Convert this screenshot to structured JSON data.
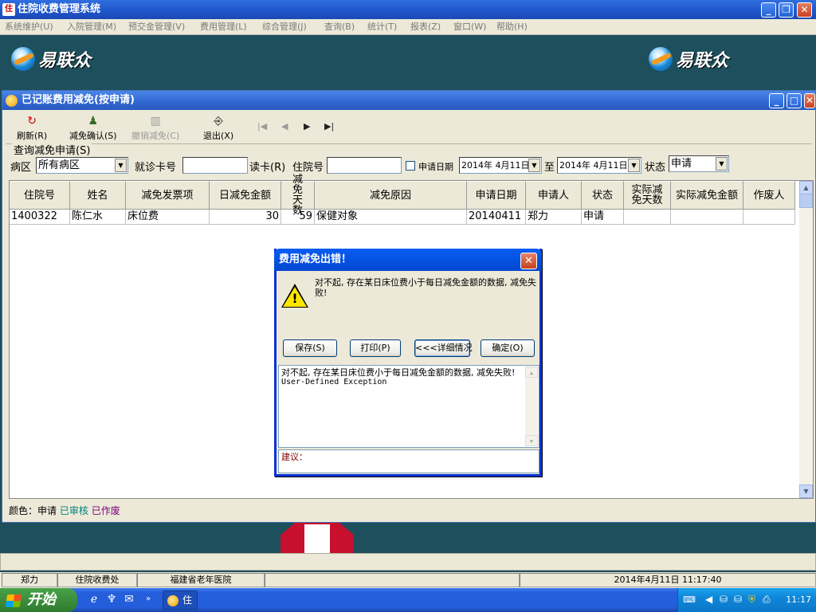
{
  "app": {
    "title": "住院收费管理系统",
    "icon": "app-logo-icon"
  },
  "menu": [
    "系统维护(U)",
    "入院管理(M)",
    "预交金管理(V)",
    "费用管理(L)",
    "综合管理(J)",
    "查询(B)",
    "统计(T)",
    "报表(Z)",
    "窗口(W)",
    "帮助(H)"
  ],
  "brand": {
    "logo_text": "易联众"
  },
  "window": {
    "title": "已记账费用减免(按申请)"
  },
  "toolbar": {
    "refresh": "刷新(R)",
    "confirm": "减免确认(S)",
    "cancel": "撤销减免(C)",
    "exit": "退出(X)",
    "nav_first": "|◀",
    "nav_prev": "◀",
    "nav_next": "▶",
    "nav_last": "▶|"
  },
  "query": {
    "group_label": "查询减免申请(S)",
    "ward_label": "病区",
    "ward_value": "所有病区",
    "card_label": "就诊卡号",
    "card_value": "",
    "read_card": "读卡(R)",
    "inpatient_label": "住院号",
    "inpatient_value": "",
    "date_check_label": "申请日期",
    "date_from": "2014年 4月11日",
    "to_label": "至",
    "date_to": "2014年 4月11日",
    "status_label": "状态",
    "status_value": "申请"
  },
  "grid": {
    "headers": [
      "住院号",
      "姓名",
      "减免发票项",
      "日减免金额",
      "减免天数",
      "减免原因",
      "申请日期",
      "申请人",
      "状态",
      "实际减免天数",
      "实际减免金额",
      "作废人"
    ],
    "rows": [
      [
        "1400322",
        "陈仁水",
        "床位费",
        "30",
        "59",
        "保健对象",
        "20140411",
        "郑力",
        "申请",
        "",
        "",
        ""
      ]
    ]
  },
  "legend": {
    "prefix": "颜色：",
    "applied": "申请",
    "reviewed": "已审核",
    "voided": "已作废",
    "colors": {
      "applied": "#000000",
      "reviewed": "#008080",
      "voided": "#800080"
    }
  },
  "dialog": {
    "title": "费用减免出错！",
    "message": "对不起, 存在某日床位费小于每日减免金额的数据, 减免失败!",
    "buttons": {
      "save": "保存(S)",
      "print": "打印(P)",
      "details": "<<<详细情况",
      "ok": "确定(O)"
    },
    "detail_message": "对不起, 存在某日床位费小于每日减免金额的数据, 减免失败!",
    "detail_exception": "User-Defined Exception",
    "advice_label": "建议："
  },
  "status_bar": {
    "user": "郑力",
    "dept": "住院收费处",
    "hospital": "福建省老年医院",
    "datetime": "2014年4月11日 11:17:40"
  },
  "taskbar": {
    "start": "开始",
    "task_label": "住",
    "clock": "11:17"
  }
}
